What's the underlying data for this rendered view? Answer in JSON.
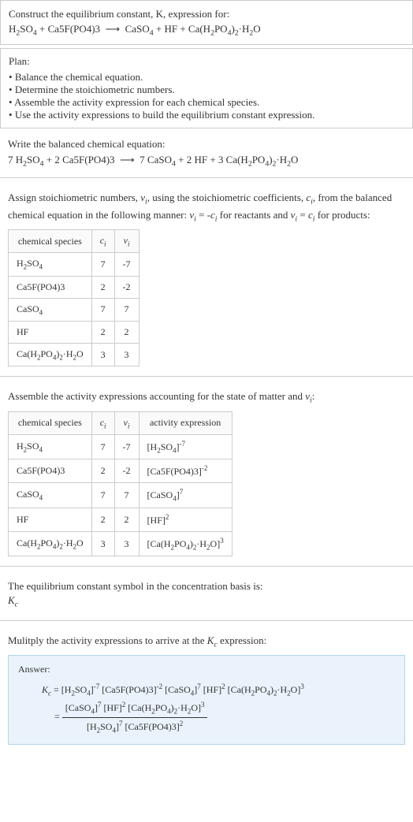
{
  "intro": {
    "prompt": "Construct the equilibrium constant, K, expression for:",
    "equation_lhs1": "H",
    "equation": "H₂SO₄ + Ca5F(PO4)3  ⟶  CaSO₄ + HF + Ca(H₂PO₄)₂·H₂O"
  },
  "plan": {
    "header": "Plan:",
    "items": [
      "Balance the chemical equation.",
      "Determine the stoichiometric numbers.",
      "Assemble the activity expression for each chemical species.",
      "Use the activity expressions to build the equilibrium constant expression."
    ]
  },
  "balanced": {
    "header": "Write the balanced chemical equation:",
    "equation": "7 H₂SO₄ + 2 Ca5F(PO4)3  ⟶  7 CaSO₄ + 2 HF + 3 Ca(H₂PO₄)₂·H₂O"
  },
  "stoich": {
    "header1": "Assign stoichiometric numbers, νᵢ, using the stoichiometric coefficients, cᵢ, from the balanced chemical equation in the following manner: νᵢ = -cᵢ for reactants and νᵢ = cᵢ for products:",
    "th_species": "chemical species",
    "th_c": "cᵢ",
    "th_v": "νᵢ",
    "rows": [
      {
        "sp": "H₂SO₄",
        "c": "7",
        "v": "-7"
      },
      {
        "sp": "Ca5F(PO4)3",
        "c": "2",
        "v": "-2"
      },
      {
        "sp": "CaSO₄",
        "c": "7",
        "v": "7"
      },
      {
        "sp": "HF",
        "c": "2",
        "v": "2"
      },
      {
        "sp": "Ca(H₂PO₄)₂·H₂O",
        "c": "3",
        "v": "3"
      }
    ]
  },
  "activity": {
    "header": "Assemble the activity expressions accounting for the state of matter and νᵢ:",
    "th_species": "chemical species",
    "th_c": "cᵢ",
    "th_v": "νᵢ",
    "th_act": "activity expression",
    "rows": [
      {
        "sp": "H₂SO₄",
        "c": "7",
        "v": "-7",
        "act": "[H₂SO₄]⁻⁷"
      },
      {
        "sp": "Ca5F(PO4)3",
        "c": "2",
        "v": "-2",
        "act": "[Ca5F(PO4)3]⁻²"
      },
      {
        "sp": "CaSO₄",
        "c": "7",
        "v": "7",
        "act": "[CaSO₄]⁷"
      },
      {
        "sp": "HF",
        "c": "2",
        "v": "2",
        "act": "[HF]²"
      },
      {
        "sp": "Ca(H₂PO₄)₂·H₂O",
        "c": "3",
        "v": "3",
        "act": "[Ca(H₂PO₄)₂·H₂O]³"
      }
    ]
  },
  "kc_symbol": {
    "line1": "The equilibrium constant symbol in the concentration basis is:",
    "line2": "K_c"
  },
  "multiply": {
    "header": "Mulitply the activity expressions to arrive at the K_c expression:"
  },
  "answer": {
    "label": "Answer:",
    "kc": "K_c",
    "expr1": "= [H₂SO₄]⁻⁷ [Ca5F(PO4)3]⁻² [CaSO₄]⁷ [HF]² [Ca(H₂PO₄)₂·H₂O]³",
    "eq": "=",
    "num": "[CaSO₄]⁷ [HF]² [Ca(H₂PO₄)₂·H₂O]³",
    "den": "[H₂SO₄]⁷ [Ca5F(PO4)3]²"
  }
}
